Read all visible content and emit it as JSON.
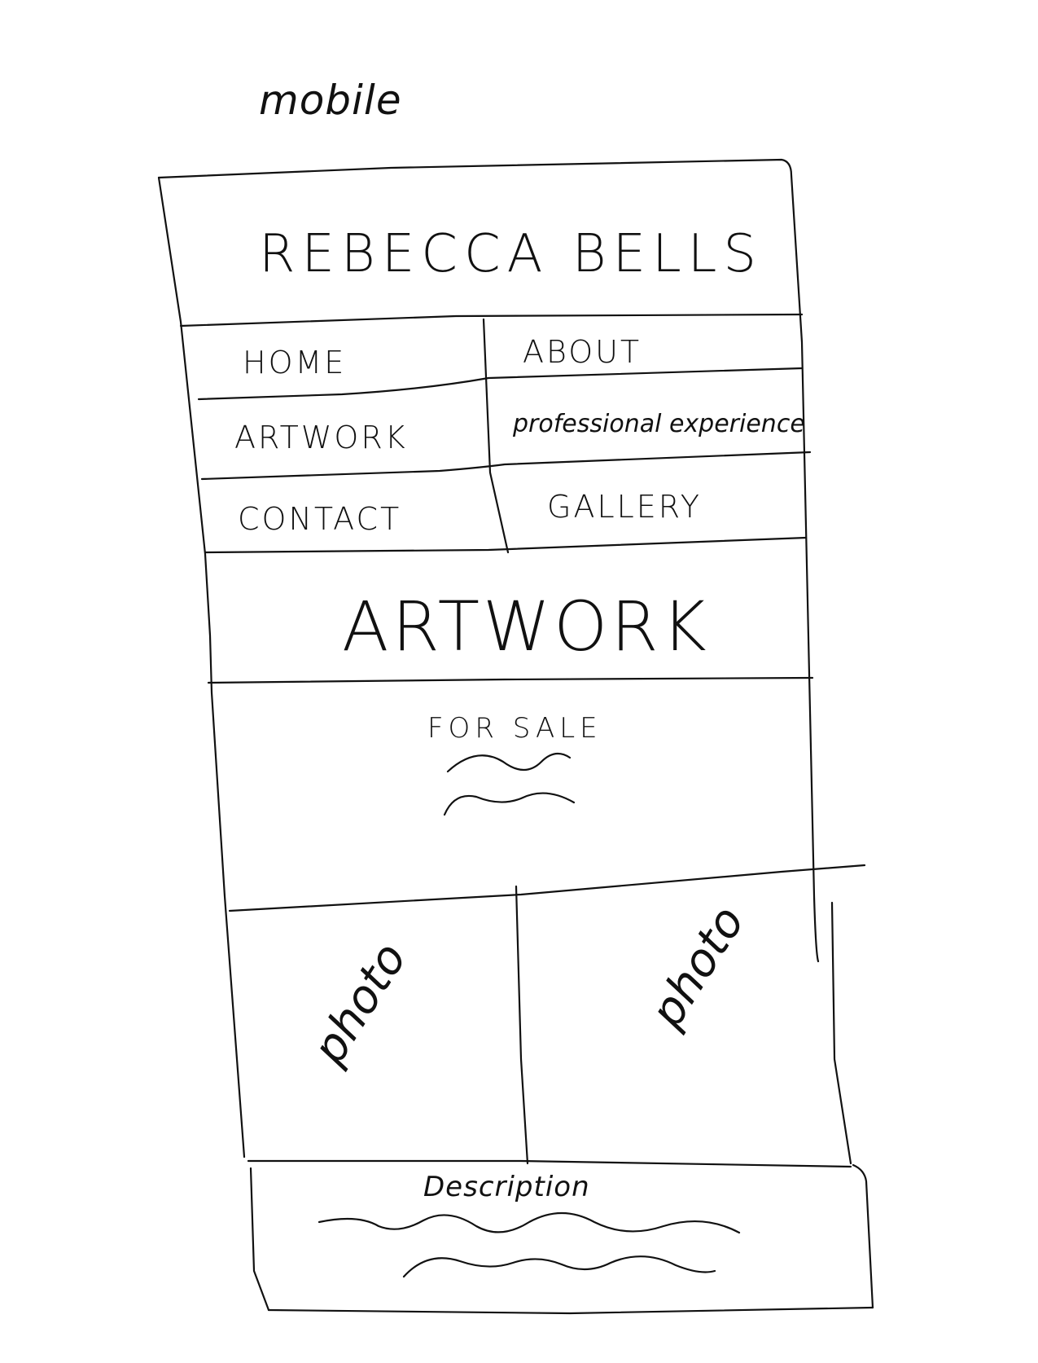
{
  "caption": "mobile",
  "header": {
    "title": "REBECCA BELLS"
  },
  "nav": {
    "items": [
      {
        "label": "HOME"
      },
      {
        "label": "ABOUT"
      },
      {
        "label": "ARTWORK"
      },
      {
        "label": "professional experience"
      },
      {
        "label": "CONTACT"
      },
      {
        "label": "GALLERY"
      }
    ]
  },
  "section": {
    "heading": "ARTWORK",
    "subheading": "FOR SALE"
  },
  "photos": [
    {
      "label": "photo"
    },
    {
      "label": "photo"
    }
  ],
  "description": {
    "label": "Description"
  },
  "colors": {
    "ink": "#111111",
    "paper": "#ffffff"
  }
}
